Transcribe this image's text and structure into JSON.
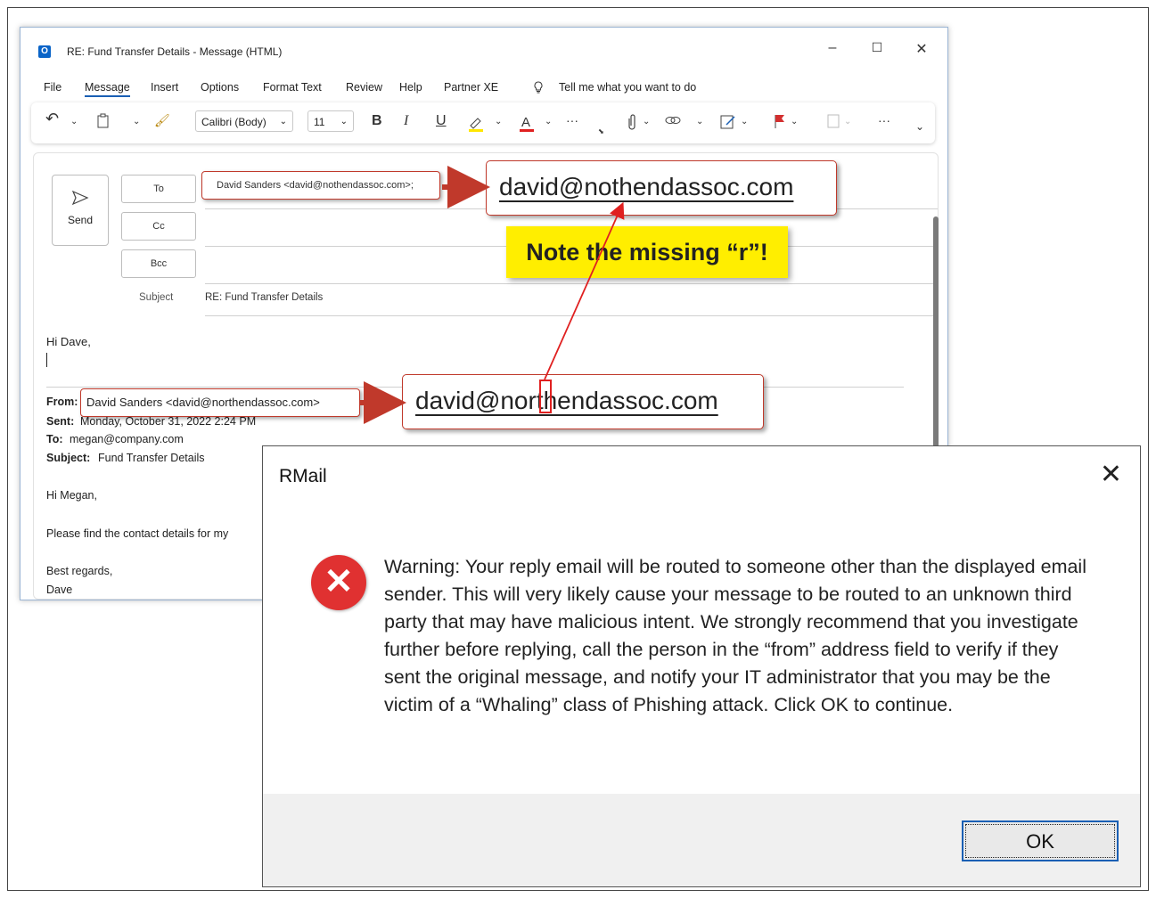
{
  "window": {
    "title": "RE: Fund Transfer Details - Message (HTML)",
    "app_icon": "O",
    "controls": [
      "–",
      "☐",
      "✕"
    ]
  },
  "menu": {
    "items": [
      "File",
      "Message",
      "Insert",
      "Options",
      "Format Text",
      "Review",
      "Help",
      "Partner XE"
    ],
    "tell_me": "Tell me what you want to do"
  },
  "ribbon": {
    "font_name": "Calibri (Body)",
    "font_size": "11",
    "bold": "B",
    "italic": "I",
    "underline": "U",
    "more": "···"
  },
  "compose": {
    "send_label": "Send",
    "to_label": "To",
    "cc_label": "Cc",
    "bcc_label": "Bcc",
    "to_value": "David Sanders <david@nothendassoc.com>;",
    "subject_label": "Subject",
    "subject_value": "RE: Fund Transfer Details"
  },
  "body": {
    "greeting": "Hi Dave,",
    "from_label": "From:",
    "from_value": "David Sanders <david@northendassoc.com>",
    "sent_label": "Sent:",
    "sent_value": "Monday, October 31, 2022 2:24 PM",
    "to_label": "To:",
    "to_value": "megan@company.com",
    "subject_label": "Subject:",
    "subject_value": "Fund Transfer Details",
    "line1": "Hi Megan,",
    "line2": "Please find the contact details for my",
    "line3": "Best regards,",
    "line4": "Dave"
  },
  "annotations": {
    "reply_address": "david@nothendassoc.com",
    "original_address": "david@northendassoc.com",
    "note": "Note the missing “r”!"
  },
  "dialog": {
    "title": "RMail",
    "close": "✕",
    "message": "Warning: Your reply email will be routed to someone other than the displayed email sender. This will very likely cause your message to be routed to an unknown third party that may have malicious intent. We strongly recommend that you investigate further before replying, call the person in the “from” address field to verify if they sent the original message, and notify your IT administrator that you may be the victim of a “Whaling” class of Phishing attack.  Click OK to continue.",
    "ok_label": "OK"
  },
  "colors": {
    "accent": "#1a5fb4",
    "highlight_red": "#c0392b",
    "note_yellow": "#ffee00",
    "error_red": "#e03131"
  }
}
